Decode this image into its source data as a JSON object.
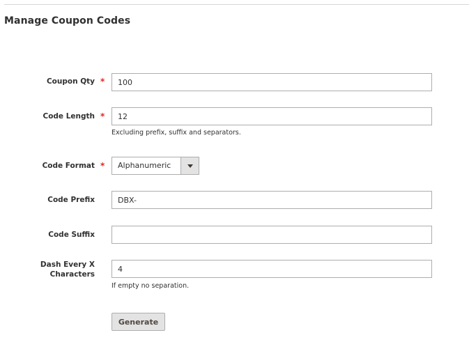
{
  "page": {
    "title": "Manage Coupon Codes"
  },
  "form": {
    "coupon_qty": {
      "label": "Coupon Qty",
      "required": "*",
      "value": "100"
    },
    "code_length": {
      "label": "Code Length",
      "required": "*",
      "value": "12",
      "note": "Excluding prefix, suffix and separators."
    },
    "code_format": {
      "label": "Code Format",
      "required": "*",
      "selected": "Alphanumeric"
    },
    "code_prefix": {
      "label": "Code Prefix",
      "value": "DBX-"
    },
    "code_suffix": {
      "label": "Code Suffix",
      "value": ""
    },
    "dash_every": {
      "label_line1": "Dash Every X",
      "label_line2": "Characters",
      "value": "4",
      "note": "If empty no separation."
    },
    "generate_label": "Generate"
  },
  "colors": {
    "required_asterisk": "#e22626",
    "button_bg": "#e3e3e3",
    "input_border": "#adadad"
  },
  "icons": {
    "select_arrow": "chevron-down-icon"
  }
}
